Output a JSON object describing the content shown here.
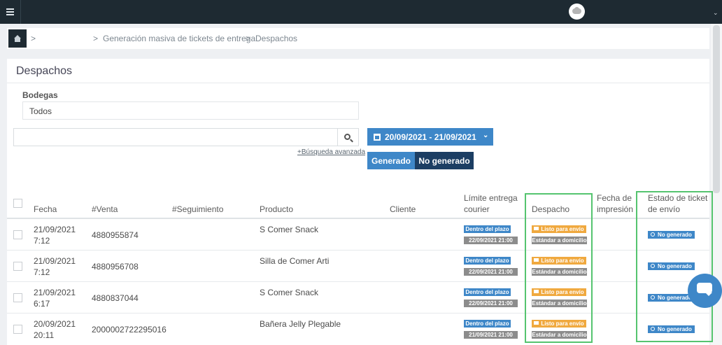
{
  "topbar": {
    "menu_icon": "hamburger-icon",
    "avatar_icon": "cloud-icon",
    "caret": "⌄"
  },
  "breadcrumb": {
    "home_icon": "home-icon",
    "sep": ">",
    "items": [
      "Generación masiva de tickets de entrega",
      "Despachos"
    ]
  },
  "page": {
    "title": "Despachos"
  },
  "filters": {
    "bodegas_label": "Bodegas",
    "bodegas_value": "Todos",
    "search_placeholder": "",
    "advanced_search": "+Búsqueda avanzada",
    "date_range": "20/09/2021 - 21/09/2021",
    "tabs": [
      "Generado",
      "No generado"
    ]
  },
  "table": {
    "headers": {
      "fecha": "Fecha",
      "venta": "#Venta",
      "seguimiento": "#Seguimiento",
      "producto": "Producto",
      "cliente": "Cliente",
      "limite_1": "Límite entrega",
      "limite_2": "courier",
      "despacho": "Despacho",
      "impresion_1": "Fecha de",
      "impresion_2": "impresión",
      "estado_1": "Estado de ticket",
      "estado_2": "de envío"
    },
    "rows": [
      {
        "fecha_d": "21/09/2021",
        "fecha_t": "7:12",
        "venta": "4880955874",
        "producto": "S Comer Snack",
        "plazo": "Dentro del plazo",
        "limite": "22/09/2021 21:00",
        "despacho_estado": "Listo para envío",
        "despacho_tipo": "Estándar a domicilio",
        "ticket": "No generado"
      },
      {
        "fecha_d": "21/09/2021",
        "fecha_t": "7:12",
        "venta": "4880956708",
        "producto": "Silla de Comer Arti",
        "plazo": "Dentro del plazo",
        "limite": "22/09/2021 21:00",
        "despacho_estado": "Listo para envío",
        "despacho_tipo": "Estándar a domicilio",
        "ticket": "No generado"
      },
      {
        "fecha_d": "21/09/2021",
        "fecha_t": "6:17",
        "venta": "4880837044",
        "producto": "S Comer Snack",
        "plazo": "Dentro del plazo",
        "limite": "22/09/2021 21:00",
        "despacho_estado": "Listo para envío",
        "despacho_tipo": "Estándar a domicilio",
        "ticket": "No generado"
      },
      {
        "fecha_d": "20/09/2021",
        "fecha_t": "20:11",
        "venta": "2000002722295016",
        "producto": "Bañera Jelly Plegable",
        "plazo": "Dentro del plazo",
        "limite": "21/09/2021 21:00",
        "despacho_estado": "Listo para envío",
        "despacho_tipo": "Estándar a domicilio",
        "ticket": "No generado"
      }
    ]
  },
  "chat": {
    "icon": "chat-bubble-icon"
  },
  "colors": {
    "accent": "#3e87c8",
    "dark": "#1e2a32",
    "highlight": "#55c46f",
    "orange": "#f0a93f"
  }
}
